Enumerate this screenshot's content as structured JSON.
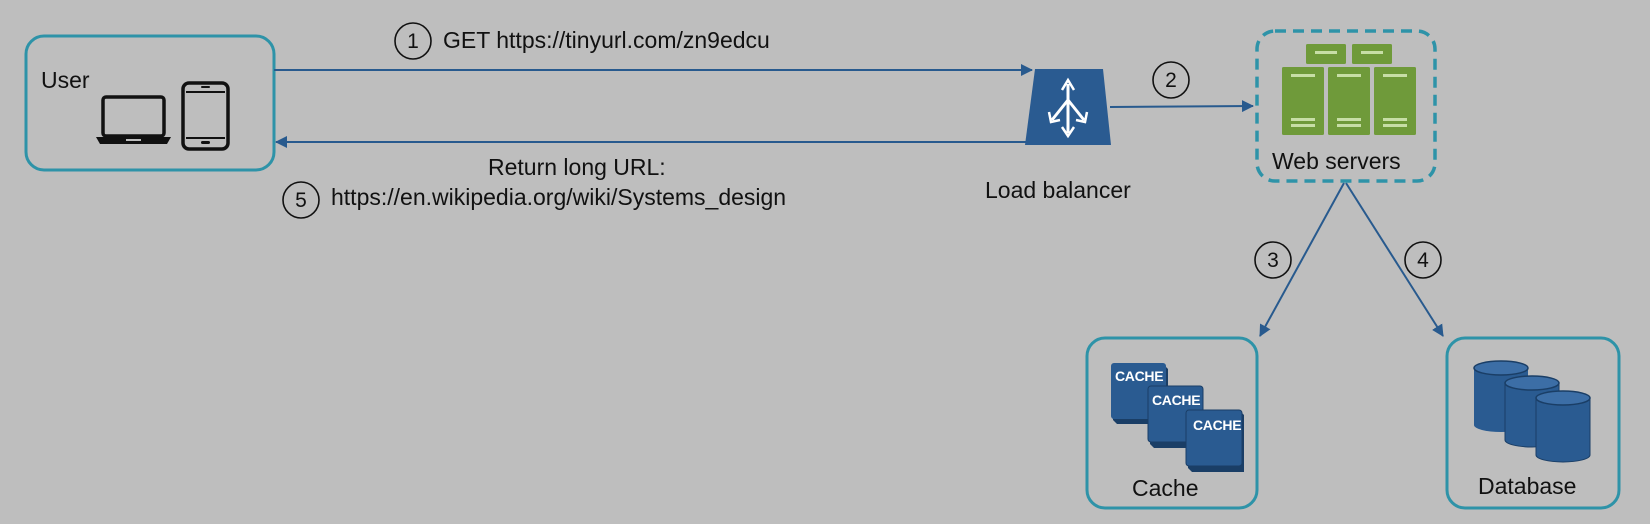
{
  "diagram": {
    "nodes": {
      "user": {
        "label": "User",
        "icons": [
          "laptop-icon",
          "tablet-icon"
        ]
      },
      "load_balancer": {
        "label": "Load balancer",
        "icon": "load-balancer-icon"
      },
      "web_servers": {
        "label": "Web servers",
        "icon": "server-rack-icon"
      },
      "cache": {
        "label": "Cache",
        "icon": "cache-stack-icon",
        "tiles": [
          "CACHE",
          "CACHE",
          "CACHE"
        ]
      },
      "database": {
        "label": "Database",
        "icon": "database-cylinders-icon"
      }
    },
    "edges": [
      {
        "step": "1",
        "from": "user",
        "to": "load_balancer",
        "label": "GET https://tinyurl.com/zn9edcu"
      },
      {
        "step": "2",
        "from": "load_balancer",
        "to": "web_servers",
        "label": ""
      },
      {
        "step": "3",
        "from": "web_servers",
        "to": "cache",
        "label": ""
      },
      {
        "step": "4",
        "from": "web_servers",
        "to": "database",
        "label": ""
      },
      {
        "step": "5",
        "from": "load_balancer",
        "to": "user",
        "label_line1": "Return long URL:",
        "label_line2": "https://en.wikipedia.org/wiki/Systems_design"
      }
    ]
  },
  "colors": {
    "background": "#bebebe",
    "node_border": "#2e93a8",
    "edge": "#285a8e",
    "icon_blue": "#2a5b91",
    "server_green": "#6f9a3a",
    "text": "#111111"
  }
}
